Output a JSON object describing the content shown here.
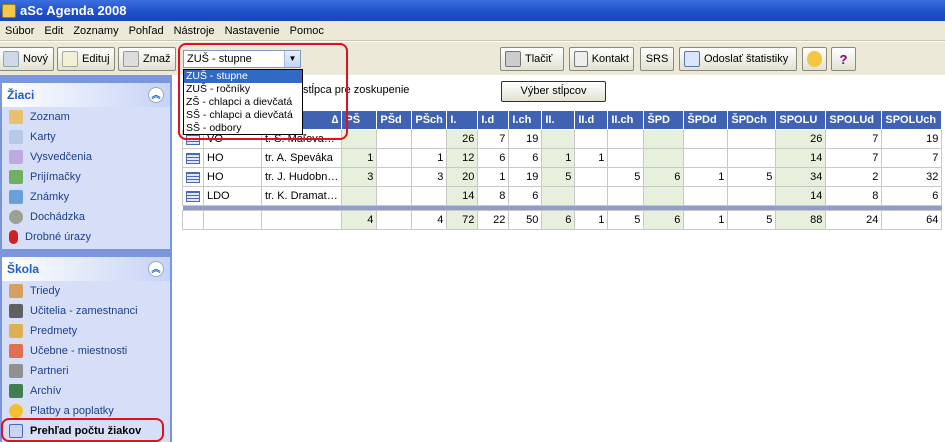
{
  "window": {
    "title": "aSc Agenda 2008"
  },
  "menu": [
    "Súbor",
    "Edit",
    "Zoznamy",
    "Pohľad",
    "Nástroje",
    "Nastavenie",
    "Pomoc"
  ],
  "toolbar": {
    "new_label": "Nový",
    "edit_label": "Edituj",
    "delete_label": "Zmaž",
    "print_label": "Tlačiť",
    "contact_label": "Kontakt",
    "srs_label": "SRS",
    "stats_label": "Odoslať štatistiky",
    "combo_value": "ZUŠ - stupne",
    "combo_options": [
      "ZUŠ - stupne",
      "ZUŠ - ročníky",
      "ZŠ - chlapci a dievčatá",
      "SŠ - chlapci a dievčatá",
      "SŠ - odbory"
    ]
  },
  "sidebar": {
    "ziaci": {
      "title": "Žiaci",
      "items": [
        "Zoznam",
        "Karty",
        "Vysvedčenia",
        "Prijímačky",
        "Známky",
        "Dochádzka",
        "Drobné úrazy"
      ]
    },
    "skola": {
      "title": "Škola",
      "items": [
        "Triedy",
        "Učitelia - zamestnanci",
        "Predmety",
        "Učebne - miestnosti",
        "Partneri",
        "Archív",
        "Platby a poplatky",
        "Prehľad počtu žiakov"
      ]
    }
  },
  "grid": {
    "group_hint": "stĺpca pre zoskupenie",
    "column_select": "Výber stĺpcov",
    "sort_indicator": "∆",
    "headers": [
      "PŠ",
      "PŠd",
      "PŠch",
      "I.",
      "I.d",
      "I.ch",
      "II.",
      "II.d",
      "II.ch",
      "ŠPD",
      "ŠPDd",
      "ŠPDch",
      "SPOLU",
      "SPOLUd",
      "SPOLUch"
    ],
    "rows": [
      {
        "type": "VO",
        "teacher": "t. S. Maľova…",
        "values": [
          "",
          "",
          "",
          "26",
          "7",
          "19",
          "",
          "",
          "",
          "",
          "",
          "",
          "26",
          "7",
          "19"
        ]
      },
      {
        "type": "HO",
        "teacher": "tr. A. Speváka",
        "values": [
          "1",
          "",
          "1",
          "12",
          "6",
          "6",
          "1",
          "1",
          "",
          "",
          "",
          "",
          "14",
          "7",
          "7"
        ]
      },
      {
        "type": "HO",
        "teacher": "tr. J. Hudobn…",
        "values": [
          "3",
          "",
          "3",
          "20",
          "1",
          "19",
          "5",
          "",
          "5",
          "6",
          "1",
          "5",
          "34",
          "2",
          "32"
        ]
      },
      {
        "type": "LDO",
        "teacher": "tr. K. Dramat…",
        "values": [
          "",
          "",
          "",
          "14",
          "8",
          "6",
          "",
          "",
          "",
          "",
          "",
          "",
          "14",
          "8",
          "6"
        ]
      }
    ],
    "totals": [
      "4",
      "",
      "4",
      "72",
      "22",
      "50",
      "6",
      "1",
      "5",
      "6",
      "1",
      "5",
      "88",
      "24",
      "64"
    ]
  }
}
